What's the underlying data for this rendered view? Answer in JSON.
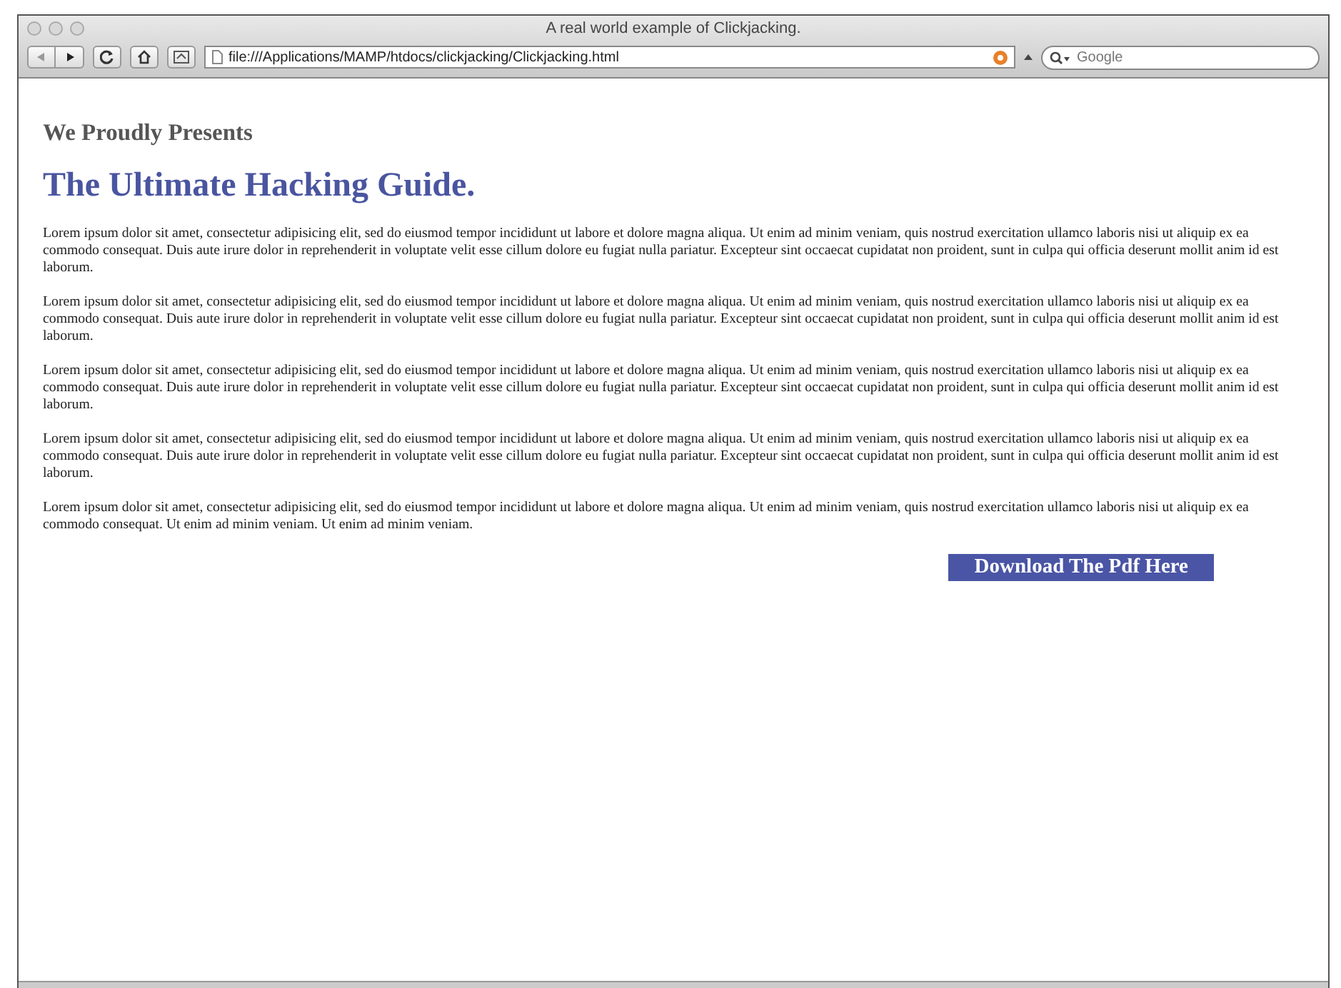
{
  "window": {
    "title": "A real world example of Clickjacking."
  },
  "toolbar": {
    "address": "file:///Applications/MAMP/htdocs/clickjacking/Clickjacking.html",
    "search": {
      "placeholder": "Google"
    }
  },
  "page": {
    "subtitle": "We Proudly Presents",
    "title": "The Ultimate Hacking Guide.",
    "paragraphs": [
      "Lorem ipsum dolor sit amet, consectetur adipisicing elit, sed do eiusmod tempor incididunt ut labore et dolore magna aliqua. Ut enim ad minim veniam, quis nostrud exercitation ullamco laboris nisi ut aliquip ex ea commodo consequat. Duis aute irure dolor in reprehenderit in voluptate velit esse cillum dolore eu fugiat nulla pariatur. Excepteur sint occaecat cupidatat non proident, sunt in culpa qui officia deserunt mollit anim id est laborum.",
      "Lorem ipsum dolor sit amet, consectetur adipisicing elit, sed do eiusmod tempor incididunt ut labore et dolore magna aliqua. Ut enim ad minim veniam, quis nostrud exercitation ullamco laboris nisi ut aliquip ex ea commodo consequat. Duis aute irure dolor in reprehenderit in voluptate velit esse cillum dolore eu fugiat nulla pariatur. Excepteur sint occaecat cupidatat non proident, sunt in culpa qui officia deserunt mollit anim id est laborum.",
      "Lorem ipsum dolor sit amet, consectetur adipisicing elit, sed do eiusmod tempor incididunt ut labore et dolore magna aliqua. Ut enim ad minim veniam, quis nostrud exercitation ullamco laboris nisi ut aliquip ex ea commodo consequat. Duis aute irure dolor in reprehenderit in voluptate velit esse cillum dolore eu fugiat nulla pariatur. Excepteur sint occaecat cupidatat non proident, sunt in culpa qui officia deserunt mollit anim id est laborum.",
      "Lorem ipsum dolor sit amet, consectetur adipisicing elit, sed do eiusmod tempor incididunt ut labore et dolore magna aliqua. Ut enim ad minim veniam, quis nostrud exercitation ullamco laboris nisi ut aliquip ex ea commodo consequat. Duis aute irure dolor in reprehenderit in voluptate velit esse cillum dolore eu fugiat nulla pariatur. Excepteur sint occaecat cupidatat non proident, sunt in culpa qui officia deserunt mollit anim id est laborum.",
      "Lorem ipsum dolor sit amet, consectetur adipisicing elit, sed do eiusmod tempor incididunt ut labore et dolore magna aliqua. Ut enim ad minim veniam, quis nostrud exercitation ullamco laboris nisi ut aliquip ex ea commodo consequat. Ut enim ad minim veniam. Ut enim ad minim veniam."
    ],
    "download_button": "Download The Pdf Here"
  }
}
